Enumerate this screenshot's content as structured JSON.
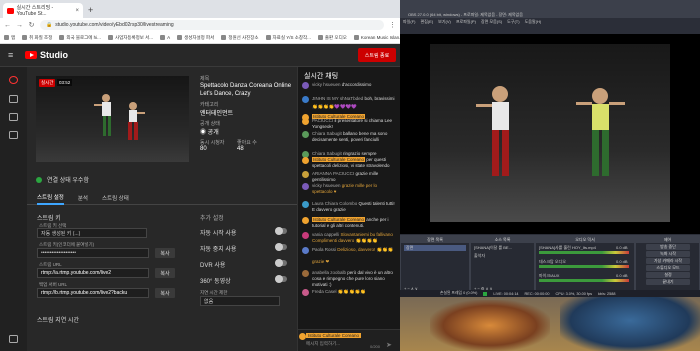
{
  "browser": {
    "tab_title": "실시간 스트리밍 - YouTube St...",
    "url": "studio.youtube.com/video/yEbd02rsp30/livestreaming",
    "bookmarks": [
      "앱",
      "취 화질 조정",
      "외국 블로그에 hi...",
      "사업자등록정보 서...",
      "A",
      "생성자설정 파서",
      "정원선 사진장소",
      "자료실 Y/S 소창작...",
      "출판 오디오",
      "Korean Music Islan...",
      "Vedith | Vedith pr..."
    ]
  },
  "studio": {
    "logo": "Studio",
    "end_stream_label": "스트림 종료",
    "live_label": "실시간",
    "live_time": "03:52",
    "title_small": "제목",
    "title": "Spettacolo Danza Coreana Online Let's Dance, Crazy",
    "category_label": "카테고리",
    "category": "엔터테인먼트",
    "privacy_label": "공개 상태",
    "privacy": "공개",
    "viewers_label": "동시 시청자",
    "viewers": "80",
    "likes_label": "좋아요 수",
    "likes": "48",
    "connection": "연결 상태 우수함",
    "tabs": [
      "스트림 설정",
      "분석",
      "스트림 상태"
    ],
    "stream_key_label": "스트림 키",
    "stream_key_select_label": "스트림 키 선택",
    "stream_key_select": "자동 생성된 키 (...)",
    "stream_key_field_label": "스트림 키(인코더에 붙여넣기)",
    "stream_key_value": "••••••••••••••••••••",
    "copy_label": "복사",
    "stream_url_label": "스트림 URL",
    "stream_url": "rtmp://a.rtmp.youtube.com/live2",
    "backup_url_label": "백업 서버 URL",
    "backup_url": "rtmp://b.rtmp.youtube.com/live2?backu",
    "latency_label": "스트림 지연 시간",
    "extra_settings_label": "추가 설정",
    "auto_start": "자동 시작 사용",
    "auto_stop": "자동 중지 사용",
    "dvr": "DVR 사용",
    "video360": "360° 동영상",
    "unlisted_label": "지연 시간 제한",
    "unlisted_value": "없음"
  },
  "chat": {
    "title": "실시간 채팅",
    "messages": [
      {
        "name": "vicky hsueuen",
        "text": "d'accordissimo"
      },
      {
        "name": "JINHN IS MY shNaTbded",
        "text": "boh, bravissimi"
      },
      {
        "name": "",
        "text": "👏👏👏👏💜💜💜💜"
      },
      {
        "name": "Istituto Culturale Coreano",
        "text": ""
      },
      {
        "name": "PACIUCCI",
        "text": "il presentatore si chiama Lee Yongseok!"
      },
      {
        "name": "Chiara Sabugit",
        "text": "ballano bene ma sono decisamente senti, poveri fanciulli"
      },
      {
        "name": "Chiara Sabugit",
        "text": "ringrazio sempre"
      },
      {
        "name": "Istituto Culturale Coreano",
        "text": "per questi spettacoli deliziosi, vi state stravolendo"
      },
      {
        "name": "ARIANNA PACIUCCI",
        "text": "grazie mille gentilissimo"
      },
      {
        "name": "vicky hsueuen",
        "text": "grazie mille per lo spettacolo ♥"
      },
      {
        "name": "Laura Chiara Colombo",
        "text": "Questi talenti tutti! E davvero grazie"
      },
      {
        "name": "Istituto Culturale Coreano",
        "text": "anche per i tutorial e gli altri contenuti."
      },
      {
        "name": "vania cappelli",
        "text": "Slovantaniemi bu fallivano Complimenti davvero 👏👏👏👏"
      },
      {
        "name": "Paola Rossi",
        "text": "Delizioso, davvero! 👏👏👏"
      },
      {
        "name": "",
        "text": "grazie ❤"
      },
      {
        "name": "anabella zoobalb",
        "text": "però dal vivo è un altro cosa e rimpegno che pure loro siano motivati :)"
      },
      {
        "name": "Freda Casel",
        "text": "👏👏👏👏👏"
      }
    ],
    "input_name": "Istituto Culturale Coreano",
    "input_placeholder": "메시지 입력하기...",
    "char_count": "0/200"
  },
  "obs": {
    "title": "OBS 27.0.0 (64 bit, windows) - 프로파일: 제목없음 - 장면: 제목없음",
    "menu": [
      "파일(F)",
      "편집(E)",
      "보기(V)",
      "프로파일(P)",
      "장면 모음(S)",
      "도구(T)",
      "도움말(H)"
    ],
    "scenes_title": "장면 목록",
    "scene": "장면",
    "sources_title": "소스 목록",
    "sources": [
      "[SHANA]이달 를 BE...",
      "출석자"
    ],
    "mixer_title": "오디오 믹서",
    "mixer": [
      {
        "name": "[SHANA]사를 홀린 HOY_Its.mp4",
        "db": "0.0 dB"
      },
      {
        "name": "데스크탑 오디오",
        "db": "0.0 dB"
      },
      {
        "name": "마이크/AUX",
        "db": "0.0 dB"
      }
    ],
    "controls_title": "제어",
    "controls": [
      "방송 중단",
      "녹화 시작",
      "가상 카메라 시작",
      "스튜디오 모드",
      "설정",
      "끝내기"
    ],
    "status": [
      "손실된 프레임 0 (0.0%)",
      "LIVE: 00:04:14",
      "REC: 00:00:00",
      "CPU: 3.0%, 30.00 fps",
      "kb/s: 2588"
    ]
  }
}
